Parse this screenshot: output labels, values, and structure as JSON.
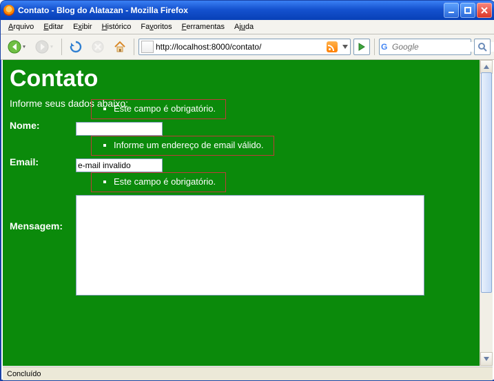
{
  "window": {
    "title": "Contato - Blog do Alatazan - Mozilla Firefox"
  },
  "menu": {
    "arquivo": "Arquivo",
    "editar": "Editar",
    "exibir": "Exibir",
    "historico": "Histórico",
    "favoritos": "Favoritos",
    "ferramentas": "Ferramentas",
    "ajuda": "Ajuda"
  },
  "nav": {
    "url": "http://localhost:8000/contato/",
    "search_placeholder": "Google",
    "search_value": ""
  },
  "page": {
    "heading": "Contato",
    "intro": "Informe seus dados abaixo:",
    "fields": {
      "nome": {
        "label": "Nome:",
        "value": "",
        "error": "Este campo é obrigatório."
      },
      "email": {
        "label": "Email:",
        "value": "e-mail invalido",
        "error": "Informe um endereço de email válido."
      },
      "mensagem": {
        "label": "Mensagem:",
        "value": "",
        "error": "Este campo é obrigatório."
      }
    }
  },
  "status": {
    "text": "Concluído"
  }
}
